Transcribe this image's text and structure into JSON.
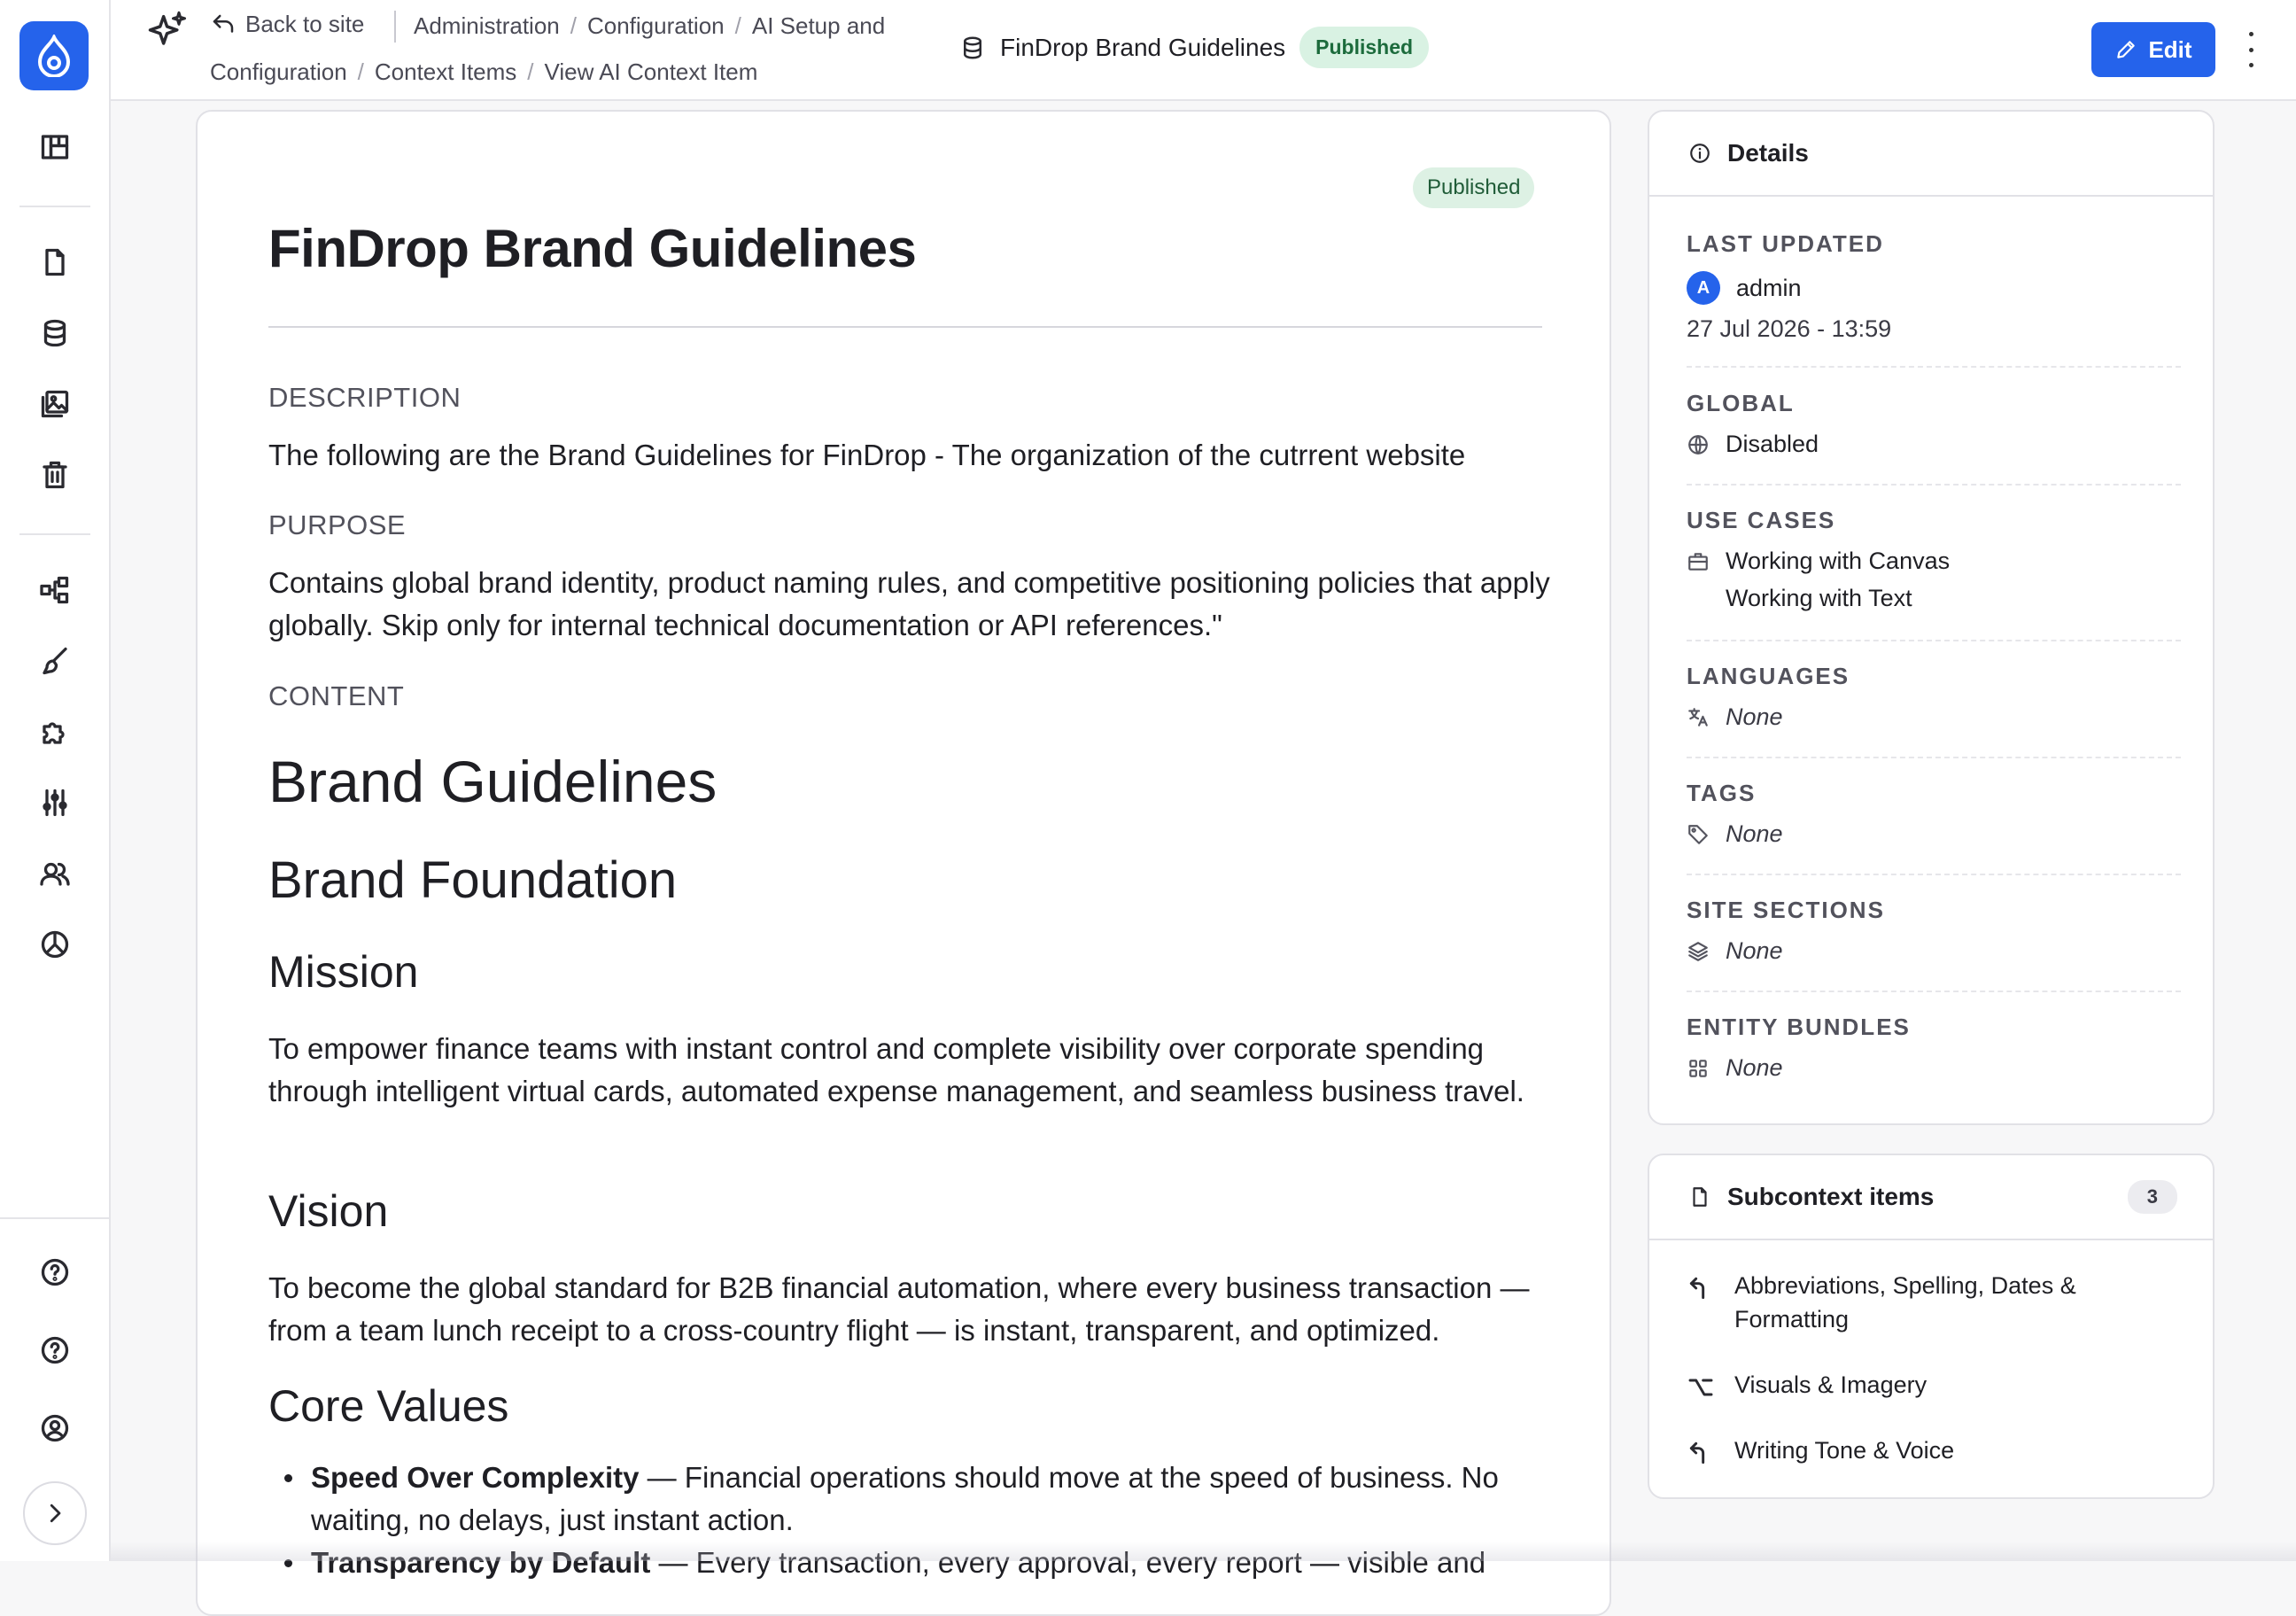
{
  "topbar": {
    "back_label": "Back to site",
    "breadcrumb": [
      "Administration",
      "Configuration",
      "AI Setup and Configuration",
      "Context Items",
      "View AI Context Item"
    ],
    "breadcrumb_line1": [
      "Administration",
      "Configuration",
      "AI Setup and"
    ],
    "breadcrumb_line2": [
      "Configuration",
      "Context Items",
      "View AI Context Item"
    ],
    "page_title": "FinDrop Brand Guidelines",
    "status": "Published",
    "edit_label": "Edit"
  },
  "sidebar": {
    "items": [
      "logo-icon",
      "dashboard-icon",
      "page-icon",
      "database-icon",
      "media-icon",
      "trash-icon",
      "structure-icon",
      "appearance-icon",
      "extend-icon",
      "config-icon",
      "people-icon",
      "reports-icon",
      "help-icon",
      "help-icon-2",
      "user-icon",
      "expand-icon"
    ]
  },
  "content": {
    "status": "Published",
    "title": "FinDrop Brand Guidelines",
    "description_label": "DESCRIPTION",
    "description": "The following are the Brand Guidelines for FinDrop - The organization of the cutrrent website",
    "purpose_label": "PURPOSE",
    "purpose": "Contains global brand identity, product naming rules, and competitive positioning policies that apply globally. Skip only for internal technical documentation or API references.\"",
    "content_label": "CONTENT",
    "h1": "Brand Guidelines",
    "h2": "Brand Foundation",
    "mission_heading": "Mission",
    "mission": "To empower finance teams with instant control and complete visibility over corporate spending through intelligent virtual cards, automated expense management, and seamless business travel.",
    "vision_heading": "Vision",
    "vision": "To become the global standard for B2B financial automation, where every business transaction — from a team lunch receipt to a cross-country flight — is instant, transparent, and optimized.",
    "values_heading": "Core Values",
    "values": [
      {
        "name": "Speed Over Complexity",
        "text": " — Financial operations should move at the speed of business. No waiting, no delays, just instant action."
      },
      {
        "name": "Transparency by Default",
        "text": " — Every transaction, every approval, every report — visible and"
      }
    ]
  },
  "details": {
    "heading": "Details",
    "last_updated_label": "LAST UPDATED",
    "user_initial": "A",
    "user": "admin",
    "date": "27 Jul 2026 - 13:59",
    "global_label": "GLOBAL",
    "global_value": "Disabled",
    "use_cases_label": "USE CASES",
    "use_cases": [
      "Working with Canvas",
      "Working with Text"
    ],
    "languages_label": "LANGUAGES",
    "languages_value": "None",
    "tags_label": "TAGS",
    "tags_value": "None",
    "site_sections_label": "SITE SECTIONS",
    "site_sections_value": "None",
    "entity_bundles_label": "ENTITY BUNDLES",
    "entity_bundles_value": "None"
  },
  "subcontext": {
    "heading": "Subcontext items",
    "count": "3",
    "items": [
      "Abbreviations, Spelling, Dates & Formatting",
      "Visuals & Imagery",
      "Writing Tone & Voice"
    ]
  },
  "colors": {
    "accent": "#2563eb",
    "published_bg": "#d9f2e3",
    "published_text": "#1c6b3c"
  }
}
